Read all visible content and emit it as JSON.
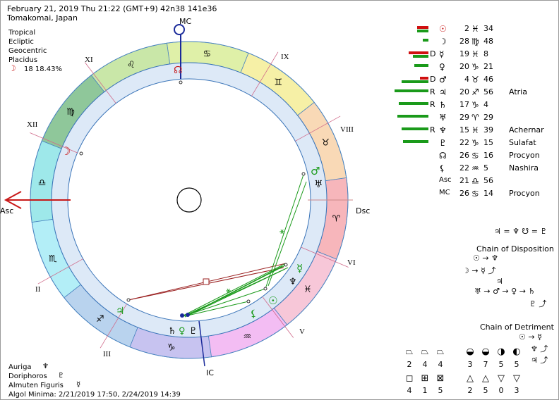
{
  "header": {
    "line1": "February 21, 2019  Thu  21:22 (GMT+9) 42n38  141e36",
    "line2": "Tomakomai, Japan"
  },
  "settings": [
    "Tropical",
    "Ecliptic",
    "Geocentric",
    "Placidus"
  ],
  "moon_phase": {
    "glyph": "☽",
    "value": "18 18.43%"
  },
  "chart_labels": {
    "mc": "MC",
    "ic": "IC",
    "asc": "Asc",
    "dsc": "Dsc",
    "houses": [
      "XI",
      "IX",
      "XII",
      "VIII",
      "II",
      "VI",
      "III",
      "V"
    ]
  },
  "planets": [
    {
      "glyph": "☉",
      "flag": "",
      "deg": "2",
      "sign": "♓",
      "min": "34",
      "star": "",
      "bars": [
        {
          "c": "#d01010",
          "w": 16
        },
        {
          "c": "#1a9a1a",
          "w": 16
        }
      ]
    },
    {
      "glyph": "☽",
      "flag": "",
      "deg": "28",
      "sign": "♍",
      "min": "48",
      "star": "",
      "bars": [
        {
          "c": "#1a9a1a",
          "w": 8
        }
      ]
    },
    {
      "glyph": "☿",
      "flag": "D",
      "deg": "19",
      "sign": "♓",
      "min": "8",
      "star": "",
      "bars": [
        {
          "c": "#d01010",
          "w": 28
        },
        {
          "c": "#1a9a1a",
          "w": 22
        }
      ]
    },
    {
      "glyph": "♀",
      "flag": "",
      "deg": "20",
      "sign": "♑",
      "min": "21",
      "star": "",
      "bars": [
        {
          "c": "#1a9a1a",
          "w": 20
        }
      ]
    },
    {
      "glyph": "♂",
      "flag": "D",
      "deg": "4",
      "sign": "♉",
      "min": "46",
      "star": "",
      "bars": [
        {
          "c": "#d01010",
          "w": 12
        },
        {
          "c": "#1a9a1a",
          "w": 38
        }
      ]
    },
    {
      "glyph": "♃",
      "flag": "R",
      "deg": "20",
      "sign": "♐",
      "min": "56",
      "star": "Atria",
      "bars": [
        {
          "c": "#1a9a1a",
          "w": 48
        }
      ]
    },
    {
      "glyph": "♄",
      "flag": "R",
      "deg": "17",
      "sign": "♑",
      "min": "4",
      "star": "",
      "bars": [
        {
          "c": "#1a9a1a",
          "w": 42
        }
      ]
    },
    {
      "glyph": "♅",
      "flag": "",
      "deg": "29",
      "sign": "♈",
      "min": "29",
      "star": "",
      "bars": [
        {
          "c": "#1a9a1a",
          "w": 44
        }
      ]
    },
    {
      "glyph": "♆",
      "flag": "R",
      "deg": "15",
      "sign": "♓",
      "min": "39",
      "star": "Achernar",
      "bars": [
        {
          "c": "#1a9a1a",
          "w": 38
        }
      ]
    },
    {
      "glyph": "♇",
      "flag": "",
      "deg": "22",
      "sign": "♑",
      "min": "15",
      "star": "Sulafat",
      "bars": [
        {
          "c": "#1a9a1a",
          "w": 36
        }
      ]
    },
    {
      "glyph": "☊",
      "flag": "",
      "deg": "26",
      "sign": "♋",
      "min": "16",
      "star": "Procyon",
      "bars": []
    },
    {
      "glyph": "⚸",
      "flag": "",
      "deg": "22",
      "sign": "♒",
      "min": "5",
      "star": "Nashira",
      "bars": []
    },
    {
      "glyph": "Asc",
      "flag": "",
      "deg": "21",
      "sign": "♎",
      "min": "56",
      "star": "",
      "bars": []
    },
    {
      "glyph": "MC",
      "flag": "",
      "deg": "26",
      "sign": "♋",
      "min": "14",
      "star": "Procyon",
      "bars": []
    }
  ],
  "reception": "♃ = ♆  ☋ = ♇",
  "disposition": {
    "title": "Chain of Disposition",
    "line1": "☉ → ♆",
    "line2": "☽ → ☿ ⤴",
    "line3": "♃",
    "line4": "♅ → ♂ → ♀ → ♄",
    "line5": "♇ ⤴"
  },
  "detriment": {
    "title": "Chain of Detriment",
    "line1": "☉ → ☿",
    "line2": "♆ ⤴",
    "line3": "♃ ⤴"
  },
  "elements_row1": {
    "glyphs": [
      "⏢",
      "⏢",
      "⏢",
      "◒",
      "◒",
      "◑",
      "◐"
    ],
    "counts": [
      "2",
      "4",
      "4",
      "3",
      "7",
      "5",
      "5"
    ]
  },
  "elements_row2": {
    "glyphs": [
      "◻",
      "⊞",
      "⊠",
      "△",
      "△",
      "▽",
      "▽"
    ],
    "counts": [
      "4",
      "1",
      "5",
      "2",
      "5",
      "0",
      "3"
    ]
  },
  "footer": [
    {
      "label": "Auriga",
      "glyph": "♆"
    },
    {
      "label": "Doriphoros",
      "glyph": "♇"
    },
    {
      "label": "Almuten Figuris",
      "glyph": "☿"
    }
  ],
  "algol": "Algol Minima: 2/21/2019 17:50,  2/24/2019 14:39",
  "colors": {
    "red": "#c81818",
    "green": "#1a9a1a",
    "blue": "#1a2a9a"
  }
}
